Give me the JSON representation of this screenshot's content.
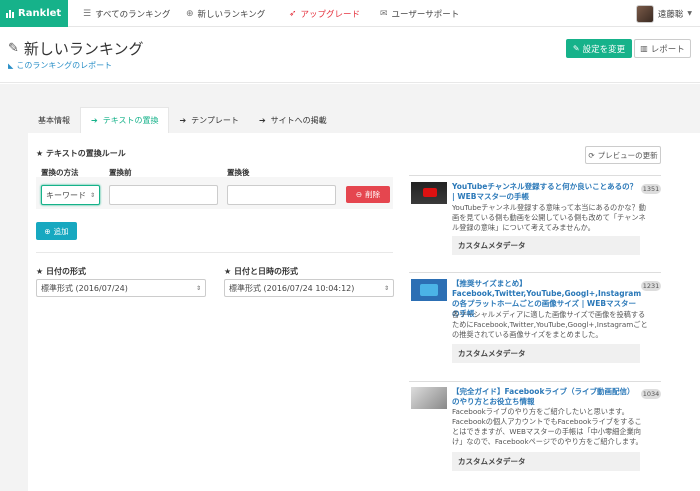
{
  "nav": {
    "brand": "Ranklet",
    "items": [
      {
        "icon": "list-icon",
        "label": "すべてのランキング"
      },
      {
        "icon": "plus-circle-icon",
        "label": "新しいランキング"
      },
      {
        "icon": "rocket-icon",
        "label": "アップグレード"
      },
      {
        "icon": "mail-icon",
        "label": "ユーザーサポート"
      }
    ],
    "user": "遠藤聡"
  },
  "header": {
    "title": "新しいランキング",
    "report_link": "このランキングのレポート",
    "save_label": "設定を変更",
    "report_label": "レポート"
  },
  "tabs": [
    {
      "label": "基本情報",
      "active": false
    },
    {
      "label": "テキストの置換",
      "active": true
    },
    {
      "label": "テンプレート",
      "active": false
    },
    {
      "label": "サイトへの掲載",
      "active": false
    }
  ],
  "replace": {
    "section_title": "★ テキストの置換ルール",
    "col_method": "置換の方法",
    "col_before": "置換前",
    "col_after": "置換後",
    "method_value": "キーワード",
    "before_value": "",
    "after_value": "",
    "delete_label": "削除",
    "add_label": "追加"
  },
  "date_format": {
    "title": "★ 日付の形式",
    "value": "標準形式 (2016/07/24)"
  },
  "datetime_format": {
    "title": "★ 日付と日時の形式",
    "value": "標準形式 (2016/07/24 10:04:12)"
  },
  "preview": {
    "refresh_label": "プレビューの更新",
    "articles": [
      {
        "title": "YouTubeチャンネル登録すると何か良いことあるの？ | WEBマスターの手帳",
        "count": "1351",
        "desc": "YouTubeチャンネル登録する意味って本当にあるのかな？動画を見ている側も動画を公開している側も改めて「チャンネル登録の意味」について考えてみませんか。",
        "meta": "カスタムメタデータ"
      },
      {
        "title": "【推奨サイズまとめ】Facebook,Twitter,YouTube,Googl+,Instagramの各プラットホームごとの画像サイズ | WEBマスターの手帳",
        "count": "1231",
        "desc": "各ソーシャルメディアに適した画像サイズで画像を投稿するためにFacebook,Twitter,YouTube,Googl+,Instagramごとの推奨されている画像サイズをまとめました。",
        "meta": "カスタムメタデータ"
      },
      {
        "title": "【完全ガイド】Facebookライブ（ライブ動画配信）のやり方とお役立ち情報",
        "count": "1034",
        "desc": "Facebookライブのやり方をご紹介したいと思います。Facebookの個人アカウントでもFacebookライブをすることはできますが、WEBマスターの手帳は「中小零細企業向け」なので、Facebookページでのやり方をご紹介します。",
        "meta": "カスタムメタデータ"
      }
    ]
  },
  "colors": {
    "brand": "#16b28a",
    "danger": "#e5464f",
    "info": "#17a8c0",
    "link": "#2a78b8"
  }
}
